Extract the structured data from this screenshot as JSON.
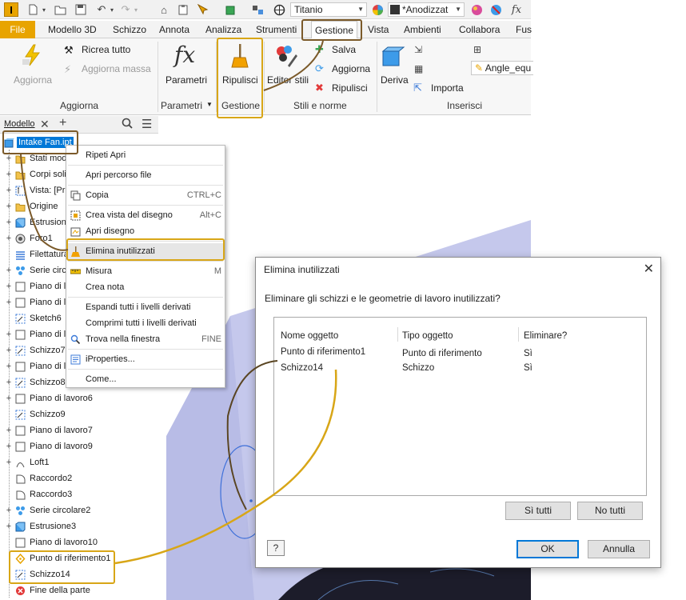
{
  "app": {
    "logo": "I"
  },
  "quick_access": {
    "material": "Titanio",
    "appearance": "*Anodizzat",
    "fx": "fx"
  },
  "tabs": [
    {
      "label": "File"
    },
    {
      "label": "Modello 3D"
    },
    {
      "label": "Schizzo"
    },
    {
      "label": "Annota"
    },
    {
      "label": "Analizza"
    },
    {
      "label": "Strumenti"
    },
    {
      "label": "Gestione"
    },
    {
      "label": "Vista"
    },
    {
      "label": "Ambienti"
    },
    {
      "label": "Collabora"
    },
    {
      "label": "Fus"
    }
  ],
  "ribbon": {
    "aggiorna": {
      "big": "Aggiorna",
      "ricrea": "Ricrea tutto",
      "massa": "Aggiorna massa",
      "group": "Aggiorna"
    },
    "parametri": {
      "big": "Parametri",
      "group": "Parametri"
    },
    "gestione": {
      "big": "Ripulisci",
      "group": "Gestione"
    },
    "stili": {
      "editor": "Editor stili",
      "salva": "Salva",
      "aggiorna": "Aggiorna",
      "ripulisci": "Ripulisci",
      "group": "Stili e norme"
    },
    "inserisci": {
      "deriva": "Deriva",
      "importa": "Importa",
      "angle": "Angle_equ",
      "group": "Inserisci"
    }
  },
  "browser": {
    "title": "Modello",
    "items": [
      {
        "label": "Intake Fan.ipt"
      },
      {
        "label": "Stati mod"
      },
      {
        "label": "Corpi soli"
      },
      {
        "label": "Vista: [Pr"
      },
      {
        "label": "Origine"
      },
      {
        "label": "Estrusione"
      },
      {
        "label": "Foro1"
      },
      {
        "label": "Filettatura"
      },
      {
        "label": "Serie circol"
      },
      {
        "label": "Piano di l"
      },
      {
        "label": "Piano di l"
      },
      {
        "label": "Sketch6"
      },
      {
        "label": "Piano di l"
      },
      {
        "label": "Schizzo7"
      },
      {
        "label": "Piano di l"
      },
      {
        "label": "Schizzo8"
      },
      {
        "label": "Piano di lavoro6"
      },
      {
        "label": "Schizzo9"
      },
      {
        "label": "Piano di lavoro7"
      },
      {
        "label": "Piano di lavoro9"
      },
      {
        "label": "Loft1"
      },
      {
        "label": "Raccordo2"
      },
      {
        "label": "Raccordo3"
      },
      {
        "label": "Serie circolare2"
      },
      {
        "label": "Estrusione3"
      },
      {
        "label": "Piano di lavoro10"
      },
      {
        "label": "Punto di riferimento1"
      },
      {
        "label": "Schizzo14"
      },
      {
        "label": "Fine della parte"
      }
    ]
  },
  "context_menu": {
    "items": [
      {
        "label": "Ripeti Apri",
        "shortcut": ""
      },
      {
        "label": "Apri percorso file",
        "shortcut": ""
      },
      {
        "label": "Copia",
        "shortcut": "CTRL+C"
      },
      {
        "label": "Crea vista del disegno",
        "shortcut": "Alt+C"
      },
      {
        "label": "Apri disegno",
        "shortcut": ""
      },
      {
        "label": "Elimina inutilizzati",
        "shortcut": ""
      },
      {
        "label": "Misura",
        "shortcut": "M"
      },
      {
        "label": "Crea nota",
        "shortcut": ""
      },
      {
        "label": "Espandi tutti i livelli derivati",
        "shortcut": ""
      },
      {
        "label": "Comprimi tutti i livelli derivati",
        "shortcut": ""
      },
      {
        "label": "Trova nella finestra",
        "shortcut": "FINE"
      },
      {
        "label": "iProperties...",
        "shortcut": ""
      },
      {
        "label": "Come...",
        "shortcut": ""
      }
    ]
  },
  "dialog": {
    "title": "Elimina inutilizzati",
    "close": "✕",
    "message": "Eliminare gli schizzi e le geometrie di lavoro inutilizzati?",
    "columns": [
      "Nome oggetto",
      "Tipo oggetto",
      "Eliminare?"
    ],
    "rows": [
      {
        "name": "Punto di riferimento1",
        "type": "Punto di riferimento",
        "delete": "Sì"
      },
      {
        "name": "Schizzo14",
        "type": "Schizzo",
        "delete": "Sì"
      }
    ],
    "buttons": {
      "yes_all": "Sì tutti",
      "no_all": "No tutti",
      "ok": "OK",
      "cancel": "Annulla",
      "help": "?"
    }
  },
  "colors": {
    "accent": "#e8a400",
    "highlight": "#d8a617",
    "callout_dark": "#7b5a2a",
    "selection": "#cce4f7",
    "model": "#c5c8ec"
  }
}
